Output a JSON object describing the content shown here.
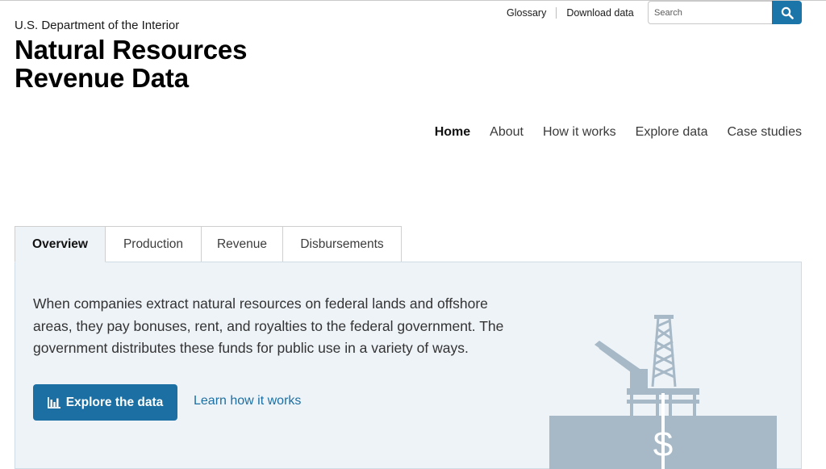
{
  "header": {
    "agency": "U.S. Department of the Interior",
    "title_line1": "Natural Resources",
    "title_line2": "Revenue Data"
  },
  "utility_nav": {
    "glossary": "Glossary",
    "download": "Download data"
  },
  "search": {
    "placeholder": "Search",
    "button_icon": "search-icon"
  },
  "main_nav": [
    {
      "label": "Home",
      "active": true
    },
    {
      "label": "About"
    },
    {
      "label": "How it works"
    },
    {
      "label": "Explore data"
    },
    {
      "label": "Case studies"
    }
  ],
  "tabs": [
    {
      "label": "Overview",
      "active": true
    },
    {
      "label": "Production"
    },
    {
      "label": "Revenue"
    },
    {
      "label": "Disbursements"
    }
  ],
  "overview": {
    "text": "When companies extract natural resources on federal lands and offshore areas, they pay bonuses, rent, and royalties to the federal government. The government distributes these funds for public use in a variety of ways.",
    "cta_label": "Explore the data",
    "cta_icon": "bar-chart-icon",
    "learn_link": "Learn how it works",
    "illustration": "offshore-rig-dollar-icon",
    "dollar_symbol": "$"
  },
  "colors": {
    "accent": "#1b6fa3",
    "panel_bg": "#eef3f8",
    "illustration": "#a7b9c7"
  }
}
